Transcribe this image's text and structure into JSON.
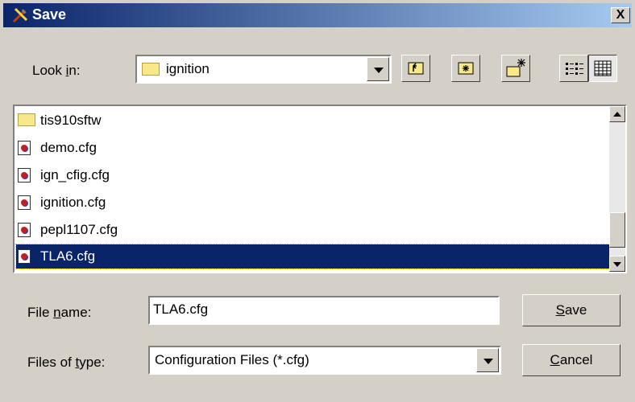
{
  "window": {
    "title": "Save",
    "close_label": "X"
  },
  "look_in": {
    "label_pre": "Look ",
    "label_key": "i",
    "label_post": "n:",
    "value": "ignition"
  },
  "toolbar": {
    "buttons": [
      {
        "name": "up-one-level",
        "icon": "folder-up-icon"
      },
      {
        "name": "home",
        "icon": "home-folder-icon"
      },
      {
        "name": "new-folder",
        "icon": "new-folder-icon"
      },
      {
        "name": "list-view",
        "icon": "list-view-icon"
      },
      {
        "name": "details-view",
        "icon": "details-view-icon"
      }
    ]
  },
  "files": [
    {
      "name": "tis910sftw",
      "type": "folder"
    },
    {
      "name": "demo.cfg",
      "type": "file"
    },
    {
      "name": "ign_cfig.cfg",
      "type": "file"
    },
    {
      "name": "ignition.cfg",
      "type": "file"
    },
    {
      "name": "pepl1107.cfg",
      "type": "file"
    },
    {
      "name": "TLA6.cfg",
      "type": "file",
      "selected": true
    }
  ],
  "file_name": {
    "label_pre": "File ",
    "label_key": "n",
    "label_post": "ame:",
    "value": "TLA6.cfg"
  },
  "file_type": {
    "label_pre": "Files of ",
    "label_key": "t",
    "label_post": "ype:",
    "value": "Configuration Files (*.cfg)"
  },
  "buttons": {
    "save_key": "S",
    "save_rest": "ave",
    "cancel_key": "C",
    "cancel_rest": "ancel"
  },
  "colors": {
    "title_start": "#0a246a",
    "title_end": "#a6caf0",
    "selection": "#0a246a",
    "face": "#d4d0c8"
  }
}
